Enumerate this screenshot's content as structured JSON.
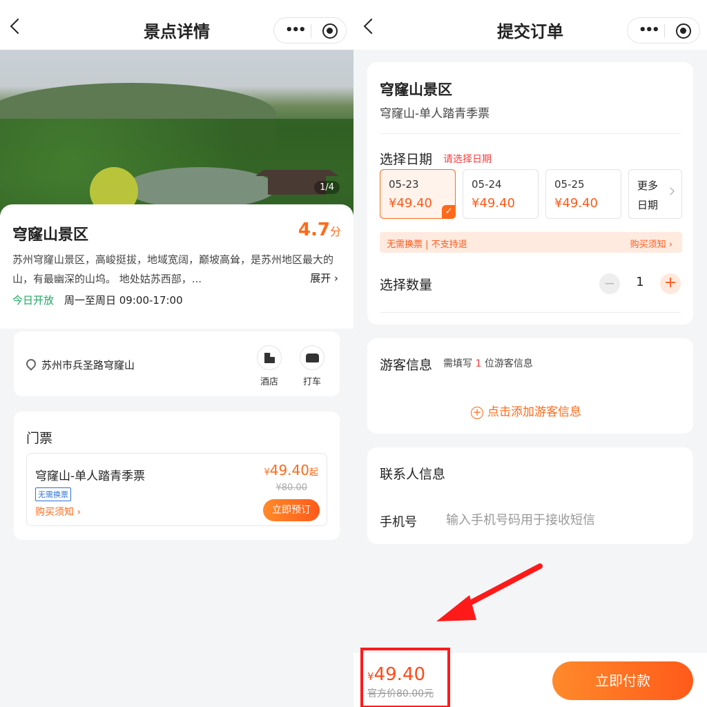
{
  "left": {
    "nav": {
      "title": "景点详情"
    },
    "hero": {
      "counter": "1/4"
    },
    "info": {
      "name": "穹窿山景区",
      "score": "4.7",
      "score_unit": "分",
      "description": "苏州穹窿山景区，高峻挺拔，地域宽阔，巅坡高耸，是苏州地区最大的山，有最幽深的山坞。 地处姑苏西部，...",
      "expand": "展开",
      "open_status": "今日开放",
      "hours": "周一至周日 09:00-17:00"
    },
    "address": {
      "text": "苏州市兵圣路穹窿山",
      "hotel_label": "酒店",
      "taxi_label": "打车"
    },
    "tickets": {
      "title": "门票",
      "item": {
        "name": "穹窿山-单人踏青季票",
        "tag": "无需换票",
        "notice": "购买须知",
        "currency": "¥",
        "price": "49.40",
        "price_suffix": "起",
        "original": "¥80.00",
        "book": "立即预订"
      }
    }
  },
  "right": {
    "nav": {
      "title": "提交订单"
    },
    "order": {
      "name": "穹窿山景区",
      "ticket": "穹窿山-单人踏青季票",
      "select_date": "选择日期",
      "select_date_hint": "请选择日期",
      "dates": [
        {
          "date": "05-23",
          "price": "¥49.40",
          "selected": true
        },
        {
          "date": "05-24",
          "price": "¥49.40",
          "selected": false
        },
        {
          "date": "05-25",
          "price": "¥49.40",
          "selected": false
        }
      ],
      "more_1": "更多",
      "more_2": "日期",
      "notice_left": "无需换票 | 不支持退",
      "notice_right": "购买须知",
      "select_qty": "选择数量",
      "qty": "1"
    },
    "visitor": {
      "title": "游客信息",
      "sub_pre": "需填写",
      "sub_num": "1",
      "sub_post": "位游客信息",
      "add": "点击添加游客信息"
    },
    "contact": {
      "title": "联系人信息",
      "phone_label": "手机号",
      "phone_placeholder": "输入手机号码用于接收短信"
    },
    "bottom": {
      "currency": "¥",
      "price": "49.40",
      "original": "官方价80.00元",
      "pay": "立即付款"
    }
  },
  "colors": {
    "accent": "#ff6a1a",
    "highlight": "#ff1a1a",
    "green": "#1aa860"
  }
}
